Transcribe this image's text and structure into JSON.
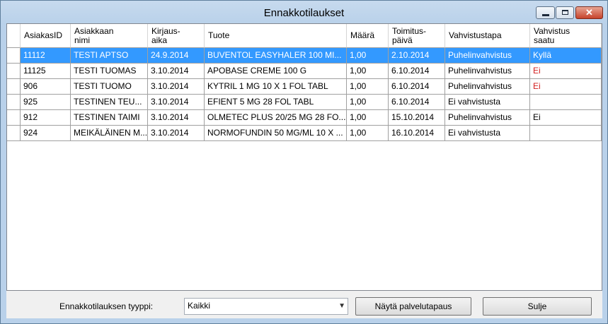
{
  "window": {
    "title": "Ennakkotilaukset"
  },
  "grid": {
    "columns": [
      "AsiakasID",
      "Asiakkaan\nnimi",
      "Kirjaus-\naika",
      "Tuote",
      "Määrä",
      "Toimitus-\npäivä",
      "Vahvistustapa",
      "Vahvistus\nsaatu"
    ],
    "rows": [
      [
        "11112",
        "TESTI APTSO",
        "24.9.2014",
        "BUVENTOL EASYHALER 100 MI...",
        "1,00",
        "2.10.2014",
        "Puhelinvahvistus",
        "Kyllä"
      ],
      [
        "11125",
        "TESTI TUOMAS",
        "3.10.2014",
        "APOBASE CREME  100 G",
        "1,00",
        "6.10.2014",
        "Puhelinvahvistus",
        "Ei"
      ],
      [
        "906",
        "TESTI TUOMO",
        "3.10.2014",
        "KYTRIL 1 MG 10 X 1 FOL TABL",
        "1,00",
        "6.10.2014",
        "Puhelinvahvistus",
        "Ei"
      ],
      [
        "925",
        "TESTINEN TEU...",
        "3.10.2014",
        "EFIENT 5 MG 28 FOL TABL",
        "1,00",
        "6.10.2014",
        "Ei vahvistusta",
        ""
      ],
      [
        "912",
        "TESTINEN TAIMI",
        "3.10.2014",
        "OLMETEC PLUS 20/25 MG 28 FO...",
        "1,00",
        "15.10.2014",
        "Puhelinvahvistus",
        "Ei"
      ],
      [
        "924",
        "MEIKÄLÄINEN M...",
        "3.10.2014",
        "NORMOFUNDIN 50 MG/ML 10 X ...",
        "1,00",
        "16.10.2014",
        "Ei vahvistusta",
        ""
      ]
    ],
    "selected_row": 0,
    "red_value": "Ei",
    "colors": {
      "selection": "#3399ff",
      "negative": "#d32020"
    }
  },
  "footer": {
    "type_label": "Ennakkotilauksen tyyppi:",
    "type_value": "Kaikki",
    "service_button": "Näytä palvelutapaus",
    "close_button": "Sulje"
  },
  "icons": [
    "minimize-icon",
    "maximize-icon",
    "close-icon",
    "dropdown-arrow-icon"
  ]
}
